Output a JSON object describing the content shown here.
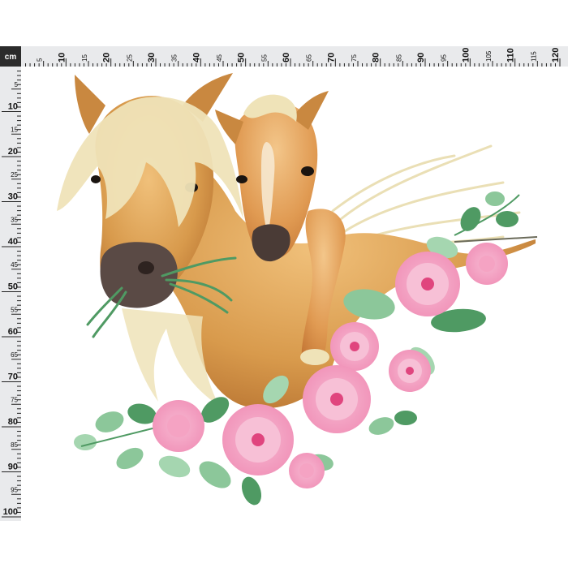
{
  "ruler": {
    "unit_label": "cm",
    "horizontal": {
      "max": 120,
      "step": 5
    },
    "vertical": {
      "max": 100,
      "step": 5
    }
  },
  "artwork": {
    "subject": "watercolor mare and foal with pink flowers",
    "colors": {
      "coat": "#d89a4c",
      "coat_dark": "#b5702f",
      "mane": "#efe3b8",
      "muzzle": "#5a4a45",
      "flower": "#f4a6c4",
      "flower_center": "#e0457e",
      "leaf": "#8cc79a",
      "leaf_dark": "#4f9a63"
    }
  },
  "icons": [
    "horse-illustration",
    "flower-icon",
    "leaf-icon"
  ]
}
